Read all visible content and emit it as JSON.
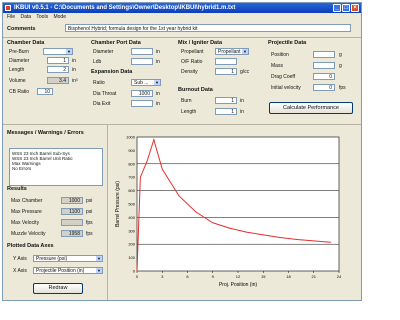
{
  "window": {
    "title": "IKBUI v0.5.1 - C:\\Documents and Settings\\Owner\\Desktop\\IKBUI\\hybrid1.m.txt"
  },
  "menu": [
    "File",
    "Data",
    "Tools",
    "Mode"
  ],
  "comments": {
    "label": "Comments",
    "value": "Bisphenol Hybrid; formula design for the 1st year hybrid kit"
  },
  "chamber": {
    "title": "Chamber Data",
    "fields": [
      {
        "label": "Pre-Burn",
        "value": "",
        "unit": "",
        "kind": "select"
      },
      {
        "label": "Diameter",
        "value": "1",
        "unit": "in"
      },
      {
        "label": "Length",
        "value": "2",
        "unit": "in"
      },
      {
        "label": "Volume",
        "value": "3.4",
        "unit": "in³",
        "readonly": true
      },
      {
        "label": "CB Ratio",
        "value": "10",
        "unit": ""
      }
    ]
  },
  "chamber_port": {
    "title": "Chamber Port Data",
    "fields": [
      {
        "label": "Diameter",
        "value": "",
        "unit": "in"
      },
      {
        "label": "Ldb",
        "value": "",
        "unit": "in"
      }
    ],
    "sub_title": "Expansion Data",
    "fields2": [
      {
        "label": "Ratio",
        "value": "Sub ...",
        "kind": "select"
      },
      {
        "label": "Dia Throat",
        "value": "1000",
        "unit": "in"
      },
      {
        "label": "Dia Exit",
        "value": "",
        "unit": "in"
      }
    ]
  },
  "mix": {
    "title": "Mix / Igniter Data",
    "fields": [
      {
        "label": "Propellant",
        "value": "Propellant",
        "kind": "select"
      },
      {
        "label": "O/F Ratio",
        "value": "",
        "unit": ""
      },
      {
        "label": "Density",
        "value": "1",
        "unit": "g/cc"
      }
    ],
    "sub_title": "Burnout Data",
    "fields2": [
      {
        "label": "Burn",
        "value": "1",
        "unit": "in"
      },
      {
        "label": "Length",
        "value": "1",
        "unit": "in"
      }
    ]
  },
  "projectile": {
    "title": "Projectile Data",
    "fields": [
      {
        "label": "Position",
        "value": "",
        "unit": "g"
      },
      {
        "label": "Mass",
        "value": "",
        "unit": "g"
      },
      {
        "label": "Drag Coeff",
        "value": "0",
        "unit": ""
      },
      {
        "label": "Initial velocity",
        "value": "0",
        "unit": "fps"
      }
    ],
    "calc_button": "Calculate Performance"
  },
  "messages": {
    "title": "Messages / Warnings / Errors",
    "lines": [
      "WSS 23 Inch Barrel Sub-Sys",
      "WSS 23 Inch Barrel Unit Ratio",
      "Max Warnings",
      "No Errors"
    ]
  },
  "results": {
    "title": "Results",
    "items": [
      {
        "label": "Max Chamber",
        "value": "1000",
        "unit": "psi"
      },
      {
        "label": "Max Pressure",
        "value": "1100",
        "unit": "psi"
      },
      {
        "label": "Max Velocity",
        "value": "",
        "unit": "fps"
      },
      {
        "label": "Muzzle Velocity",
        "value": "1958",
        "unit": "fps"
      }
    ]
  },
  "plotted": {
    "title": "Plotted Data Axes",
    "y_label": "Y Axis",
    "y_value": "Pressure (psi)",
    "x_label": "X Axis",
    "x_value": "Projectile Position (in)",
    "button": "Redraw"
  },
  "chart_data": {
    "type": "line",
    "xlabel": "Proj. Position (in)",
    "ylabel": "Barrel Pressure (psi)",
    "xlim": [
      0,
      24
    ],
    "ylim": [
      0,
      1000
    ],
    "x_ticks": [
      "0",
      "3",
      "6",
      "9",
      "12",
      "15",
      "18",
      "21",
      "24"
    ],
    "y_ticks": [
      "0",
      "100",
      "200",
      "300",
      "400",
      "500",
      "600",
      "700",
      "800",
      "900",
      "1000"
    ],
    "color": "#e03030",
    "x": [
      0,
      0.4,
      1.2,
      2.0,
      3.0,
      5.0,
      7.0,
      9.0,
      11.0,
      13.0,
      15.0,
      17.0,
      19.0,
      21.0,
      23.0
    ],
    "y": [
      0,
      700,
      820,
      980,
      760,
      560,
      440,
      360,
      320,
      290,
      270,
      250,
      235,
      225,
      215
    ]
  }
}
